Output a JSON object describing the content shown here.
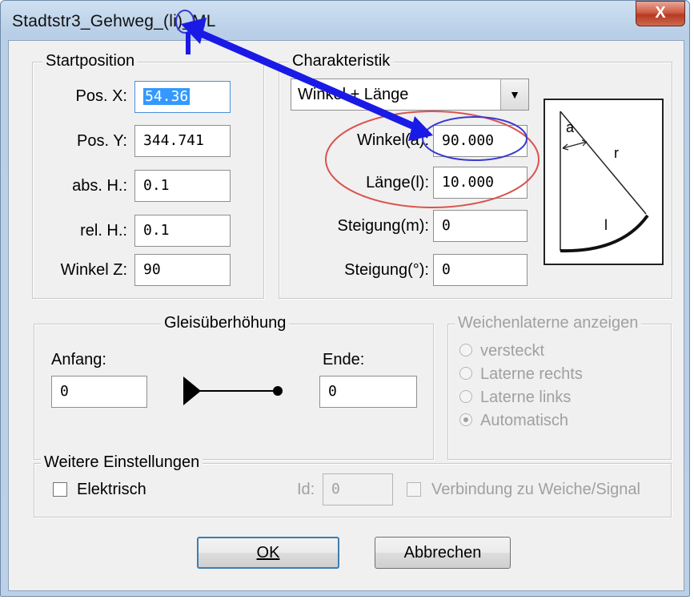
{
  "window": {
    "title": "Stadtstr3_Gehweg_(li)_ML",
    "close_label": "X"
  },
  "startposition": {
    "legend": "Startposition",
    "fields": [
      {
        "label": "Pos. X:",
        "value": "54.36"
      },
      {
        "label": "Pos. Y:",
        "value": "344.741"
      },
      {
        "label": "abs. H.:",
        "value": "0.1"
      },
      {
        "label": "rel. H.:",
        "value": "0.1"
      },
      {
        "label": "Winkel Z:",
        "value": "90"
      }
    ]
  },
  "charakteristik": {
    "legend": "Charakteristik",
    "dropdown_value": "Winkel + Länge",
    "fields": [
      {
        "label": "Winkel(a):",
        "value": "90.000"
      },
      {
        "label": "Länge(l):",
        "value": "10.000"
      },
      {
        "label": "Steigung(m):",
        "value": "0"
      },
      {
        "label": "Steigung(°):",
        "value": "0"
      }
    ],
    "diagram_labels": {
      "a": "a",
      "r": "r",
      "l": "l"
    }
  },
  "gleis": {
    "legend": "Gleisüberhöhung",
    "anfang_label": "Anfang:",
    "anfang_value": "0",
    "ende_label": "Ende:",
    "ende_value": "0"
  },
  "laterne": {
    "legend": "Weichenlaterne anzeigen",
    "options": [
      "versteckt",
      "Laterne rechts",
      "Laterne links",
      "Automatisch"
    ],
    "selected": "Automatisch"
  },
  "weitere": {
    "legend": "Weitere Einstellungen",
    "elektrisch_label": "Elektrisch",
    "id_label": "Id:",
    "id_value": "0",
    "verbindung_label": "Verbindung zu Weiche/Signal"
  },
  "buttons": {
    "ok_label": "OK",
    "cancel_label": "Abbrechen"
  },
  "colors": {
    "annotation_arrow": "#1a1ae6",
    "annotation_red_ellipse": "#d9534f",
    "annotation_blue_ellipse": "#3a3ad0",
    "selection": "#3399ff"
  }
}
